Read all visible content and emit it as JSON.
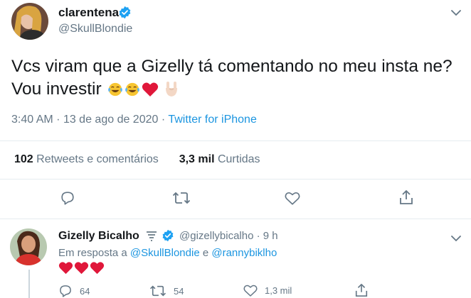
{
  "main_tweet": {
    "author_name": "clarentena",
    "handle": "@SkullBlondie",
    "text": "Vcs viram que a Gizelly tá comentando no meu insta ne? Vou investir",
    "emojis": [
      "face-with-tears-of-joy",
      "face-with-tears-of-joy",
      "red-heart",
      "sign-of-the-horns"
    ],
    "time": "3:40 AM",
    "date": "13 de ago de 2020",
    "separator": "·",
    "source": "Twitter for iPhone",
    "retweets_count": "102",
    "retweets_label": "Retweets e comentários",
    "likes_count": "3,3 mil",
    "likes_label": "Curtidas"
  },
  "reply": {
    "author_name": "Gizelly Bicalho",
    "handle": "@gizellybicalho",
    "time_ago": "· 9 h",
    "reply_prefix": "Em resposta a",
    "reply_user_1": "@SkullBlondie",
    "reply_and": "e",
    "reply_user_2": "@rannybiklho",
    "hearts": [
      "red-heart",
      "red-heart",
      "red-heart"
    ],
    "replies_count": "64",
    "retweets_count": "54",
    "likes_count": "1,3 mil"
  },
  "colors": {
    "text": "#14171a",
    "secondary": "#657786",
    "link": "#1b95e0",
    "verified": "#1da1f2",
    "divider": "#e6ecf0",
    "heart": "#e0245e"
  }
}
